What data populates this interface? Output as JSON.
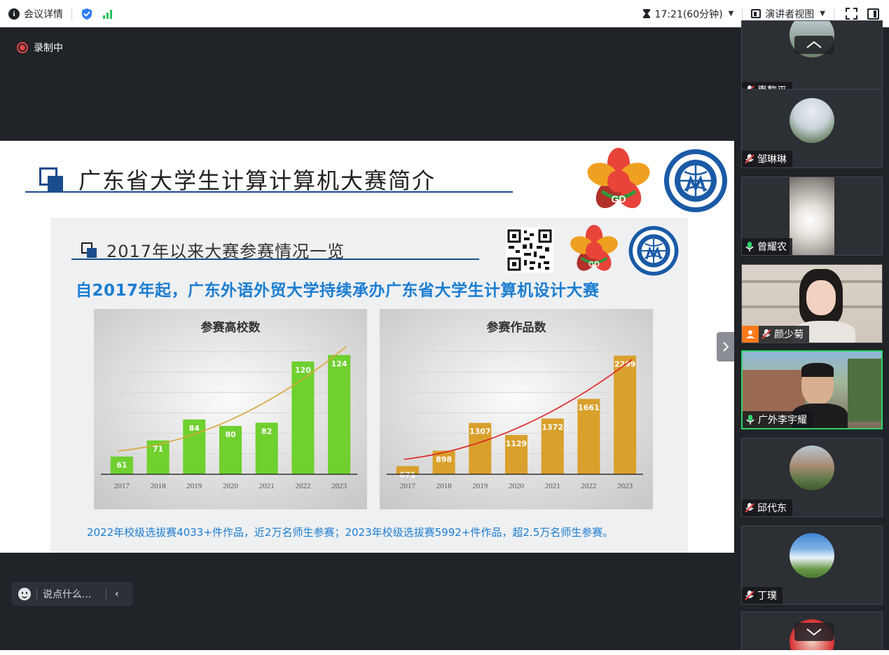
{
  "topbar": {
    "meeting_details": "会议详情",
    "timer": "17:21(60分钟)",
    "presenter_view": "演讲者视图"
  },
  "recording": {
    "label": "录制中",
    "color": "#e54545"
  },
  "slide": {
    "title": "广东省大学生计算计算机大赛简介",
    "logo_gd_text": "GD",
    "inner_title": "2017年以来大赛参赛情况一览",
    "subtitle": "自2017年起，广东外语外贸大学持续承办广东省大学生计算机设计大赛",
    "footnote": "2022年校级选拔赛4033+件作品，近2万名师生参赛；2023年校级选拔赛5992+件作品，超2.5万名师生参赛。"
  },
  "chart_data": [
    {
      "type": "bar",
      "title": "参赛高校数",
      "categories": [
        "2017",
        "2018",
        "2019",
        "2020",
        "2021",
        "2022",
        "2023"
      ],
      "values": [
        61,
        71,
        84,
        80,
        82,
        120,
        124
      ],
      "ylim": [
        50,
        130
      ],
      "trendline": true,
      "bar_color": "#6fd02e",
      "trend_color": "#d9a63a",
      "label_color": "#ffffff"
    },
    {
      "type": "bar",
      "title": "参赛作品数",
      "categories": [
        "2017",
        "2018",
        "2019",
        "2020",
        "2021",
        "2022",
        "2023"
      ],
      "values": [
        671,
        898,
        1307,
        1129,
        1372,
        1661,
        2299
      ],
      "ylim": [
        550,
        2450
      ],
      "trendline": true,
      "bar_color": "#d9a02c",
      "trend_color": "#e02020",
      "label_color": "#ffffff"
    }
  ],
  "chat": {
    "placeholder": "说点什么..."
  },
  "participants": [
    {
      "name": "惠黎平",
      "mic": "muted"
    },
    {
      "name": "邹琳琳",
      "mic": "muted"
    },
    {
      "name": "曾耀农",
      "mic": "on"
    },
    {
      "name": "颜少菊",
      "mic": "muted",
      "host": true
    },
    {
      "name": "广外李宇耀",
      "mic": "on",
      "active": true
    },
    {
      "name": "邱代东",
      "mic": "muted"
    },
    {
      "name": "丁璞",
      "mic": "muted"
    }
  ],
  "colors": {
    "accent_green": "#2fd36a",
    "brand_blue": "#1a4c8c",
    "subtitle_blue": "#1b7dd1"
  }
}
